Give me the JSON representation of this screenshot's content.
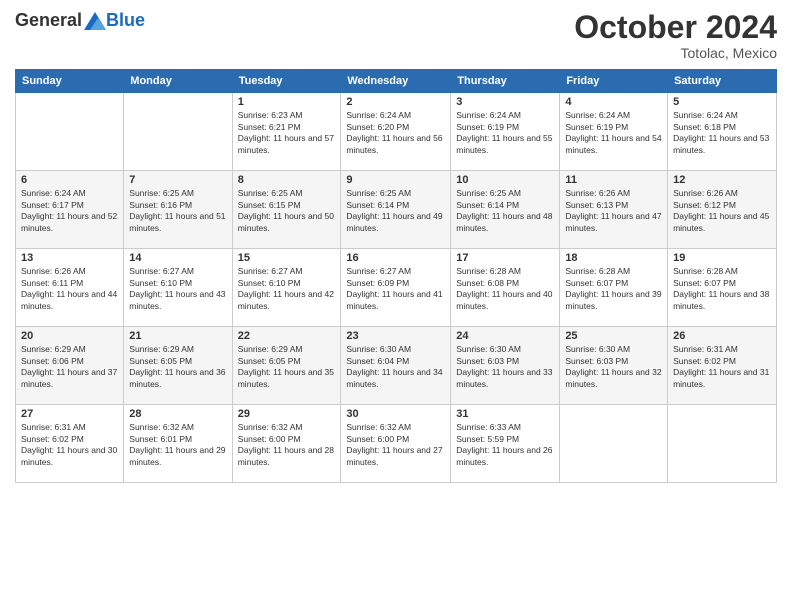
{
  "header": {
    "logo_general": "General",
    "logo_blue": "Blue",
    "month_title": "October 2024",
    "location": "Totolac, Mexico"
  },
  "days_of_week": [
    "Sunday",
    "Monday",
    "Tuesday",
    "Wednesday",
    "Thursday",
    "Friday",
    "Saturday"
  ],
  "weeks": [
    [
      {
        "day": "",
        "sunrise": "",
        "sunset": "",
        "daylight": ""
      },
      {
        "day": "",
        "sunrise": "",
        "sunset": "",
        "daylight": ""
      },
      {
        "day": "1",
        "sunrise": "Sunrise: 6:23 AM",
        "sunset": "Sunset: 6:21 PM",
        "daylight": "Daylight: 11 hours and 57 minutes."
      },
      {
        "day": "2",
        "sunrise": "Sunrise: 6:24 AM",
        "sunset": "Sunset: 6:20 PM",
        "daylight": "Daylight: 11 hours and 56 minutes."
      },
      {
        "day": "3",
        "sunrise": "Sunrise: 6:24 AM",
        "sunset": "Sunset: 6:19 PM",
        "daylight": "Daylight: 11 hours and 55 minutes."
      },
      {
        "day": "4",
        "sunrise": "Sunrise: 6:24 AM",
        "sunset": "Sunset: 6:19 PM",
        "daylight": "Daylight: 11 hours and 54 minutes."
      },
      {
        "day": "5",
        "sunrise": "Sunrise: 6:24 AM",
        "sunset": "Sunset: 6:18 PM",
        "daylight": "Daylight: 11 hours and 53 minutes."
      }
    ],
    [
      {
        "day": "6",
        "sunrise": "Sunrise: 6:24 AM",
        "sunset": "Sunset: 6:17 PM",
        "daylight": "Daylight: 11 hours and 52 minutes."
      },
      {
        "day": "7",
        "sunrise": "Sunrise: 6:25 AM",
        "sunset": "Sunset: 6:16 PM",
        "daylight": "Daylight: 11 hours and 51 minutes."
      },
      {
        "day": "8",
        "sunrise": "Sunrise: 6:25 AM",
        "sunset": "Sunset: 6:15 PM",
        "daylight": "Daylight: 11 hours and 50 minutes."
      },
      {
        "day": "9",
        "sunrise": "Sunrise: 6:25 AM",
        "sunset": "Sunset: 6:14 PM",
        "daylight": "Daylight: 11 hours and 49 minutes."
      },
      {
        "day": "10",
        "sunrise": "Sunrise: 6:25 AM",
        "sunset": "Sunset: 6:14 PM",
        "daylight": "Daylight: 11 hours and 48 minutes."
      },
      {
        "day": "11",
        "sunrise": "Sunrise: 6:26 AM",
        "sunset": "Sunset: 6:13 PM",
        "daylight": "Daylight: 11 hours and 47 minutes."
      },
      {
        "day": "12",
        "sunrise": "Sunrise: 6:26 AM",
        "sunset": "Sunset: 6:12 PM",
        "daylight": "Daylight: 11 hours and 45 minutes."
      }
    ],
    [
      {
        "day": "13",
        "sunrise": "Sunrise: 6:26 AM",
        "sunset": "Sunset: 6:11 PM",
        "daylight": "Daylight: 11 hours and 44 minutes."
      },
      {
        "day": "14",
        "sunrise": "Sunrise: 6:27 AM",
        "sunset": "Sunset: 6:10 PM",
        "daylight": "Daylight: 11 hours and 43 minutes."
      },
      {
        "day": "15",
        "sunrise": "Sunrise: 6:27 AM",
        "sunset": "Sunset: 6:10 PM",
        "daylight": "Daylight: 11 hours and 42 minutes."
      },
      {
        "day": "16",
        "sunrise": "Sunrise: 6:27 AM",
        "sunset": "Sunset: 6:09 PM",
        "daylight": "Daylight: 11 hours and 41 minutes."
      },
      {
        "day": "17",
        "sunrise": "Sunrise: 6:28 AM",
        "sunset": "Sunset: 6:08 PM",
        "daylight": "Daylight: 11 hours and 40 minutes."
      },
      {
        "day": "18",
        "sunrise": "Sunrise: 6:28 AM",
        "sunset": "Sunset: 6:07 PM",
        "daylight": "Daylight: 11 hours and 39 minutes."
      },
      {
        "day": "19",
        "sunrise": "Sunrise: 6:28 AM",
        "sunset": "Sunset: 6:07 PM",
        "daylight": "Daylight: 11 hours and 38 minutes."
      }
    ],
    [
      {
        "day": "20",
        "sunrise": "Sunrise: 6:29 AM",
        "sunset": "Sunset: 6:06 PM",
        "daylight": "Daylight: 11 hours and 37 minutes."
      },
      {
        "day": "21",
        "sunrise": "Sunrise: 6:29 AM",
        "sunset": "Sunset: 6:05 PM",
        "daylight": "Daylight: 11 hours and 36 minutes."
      },
      {
        "day": "22",
        "sunrise": "Sunrise: 6:29 AM",
        "sunset": "Sunset: 6:05 PM",
        "daylight": "Daylight: 11 hours and 35 minutes."
      },
      {
        "day": "23",
        "sunrise": "Sunrise: 6:30 AM",
        "sunset": "Sunset: 6:04 PM",
        "daylight": "Daylight: 11 hours and 34 minutes."
      },
      {
        "day": "24",
        "sunrise": "Sunrise: 6:30 AM",
        "sunset": "Sunset: 6:03 PM",
        "daylight": "Daylight: 11 hours and 33 minutes."
      },
      {
        "day": "25",
        "sunrise": "Sunrise: 6:30 AM",
        "sunset": "Sunset: 6:03 PM",
        "daylight": "Daylight: 11 hours and 32 minutes."
      },
      {
        "day": "26",
        "sunrise": "Sunrise: 6:31 AM",
        "sunset": "Sunset: 6:02 PM",
        "daylight": "Daylight: 11 hours and 31 minutes."
      }
    ],
    [
      {
        "day": "27",
        "sunrise": "Sunrise: 6:31 AM",
        "sunset": "Sunset: 6:02 PM",
        "daylight": "Daylight: 11 hours and 30 minutes."
      },
      {
        "day": "28",
        "sunrise": "Sunrise: 6:32 AM",
        "sunset": "Sunset: 6:01 PM",
        "daylight": "Daylight: 11 hours and 29 minutes."
      },
      {
        "day": "29",
        "sunrise": "Sunrise: 6:32 AM",
        "sunset": "Sunset: 6:00 PM",
        "daylight": "Daylight: 11 hours and 28 minutes."
      },
      {
        "day": "30",
        "sunrise": "Sunrise: 6:32 AM",
        "sunset": "Sunset: 6:00 PM",
        "daylight": "Daylight: 11 hours and 27 minutes."
      },
      {
        "day": "31",
        "sunrise": "Sunrise: 6:33 AM",
        "sunset": "Sunset: 5:59 PM",
        "daylight": "Daylight: 11 hours and 26 minutes."
      },
      {
        "day": "",
        "sunrise": "",
        "sunset": "",
        "daylight": ""
      },
      {
        "day": "",
        "sunrise": "",
        "sunset": "",
        "daylight": ""
      }
    ]
  ]
}
